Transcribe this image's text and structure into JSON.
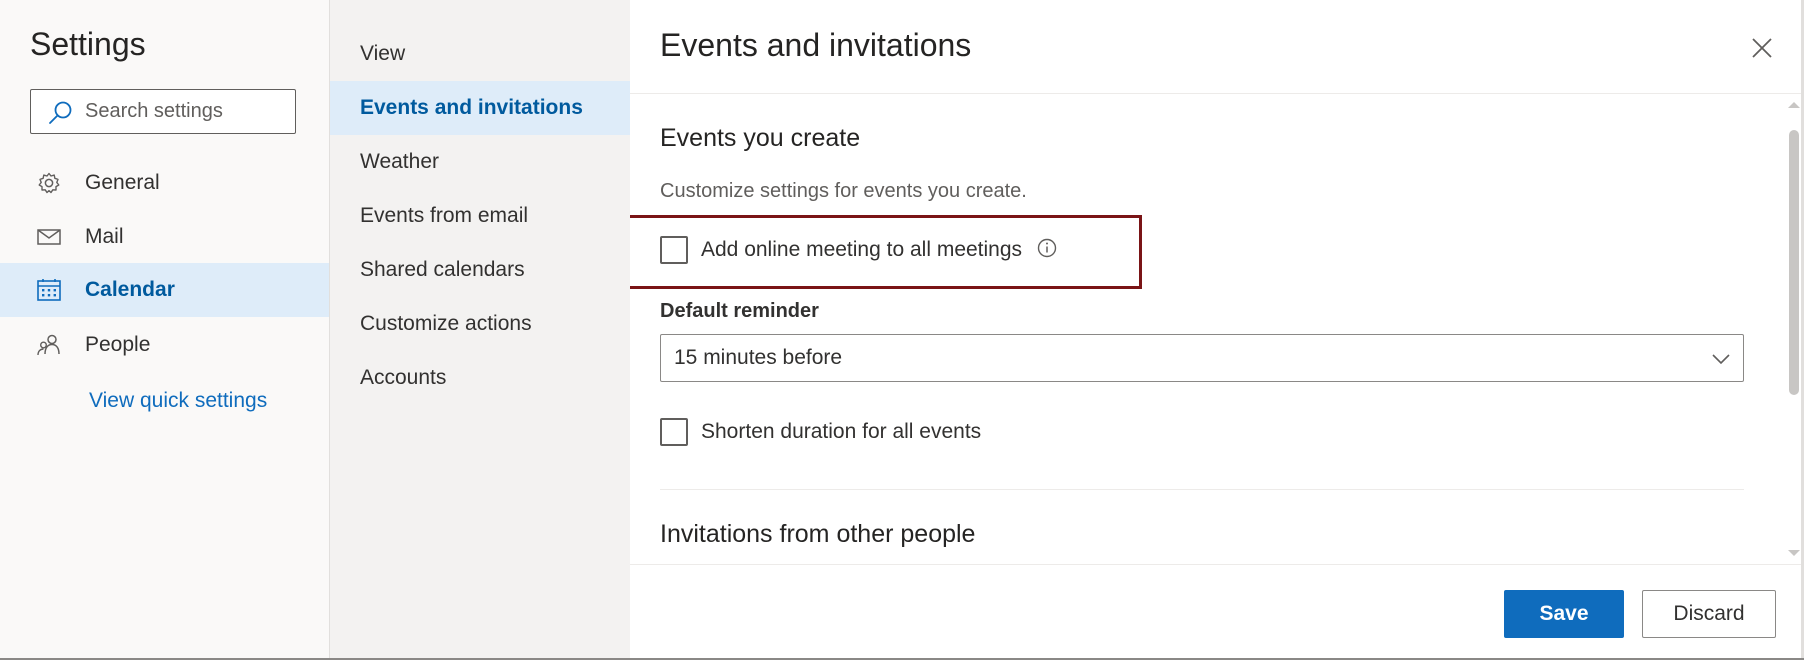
{
  "settings": {
    "title": "Settings",
    "search_placeholder": "Search settings",
    "nav": [
      {
        "label": "General",
        "icon": "gear-icon"
      },
      {
        "label": "Mail",
        "icon": "mail-icon"
      },
      {
        "label": "Calendar",
        "icon": "calendar-icon",
        "active": true
      },
      {
        "label": "People",
        "icon": "people-icon"
      }
    ],
    "quick_settings": "View quick settings"
  },
  "calendar_menu": {
    "items": [
      {
        "label": "View"
      },
      {
        "label": "Events and invitations",
        "active": true
      },
      {
        "label": "Weather"
      },
      {
        "label": "Events from email"
      },
      {
        "label": "Shared calendars"
      },
      {
        "label": "Customize actions"
      },
      {
        "label": "Accounts"
      }
    ]
  },
  "panel": {
    "title": "Events and invitations",
    "events_you_create": {
      "heading": "Events you create",
      "description": "Customize settings for events you create.",
      "online_meeting_label": "Add online meeting to all meetings",
      "online_meeting_checked": false,
      "default_reminder_label": "Default reminder",
      "default_reminder_value": "15 minutes before",
      "shorten_duration_label": "Shorten duration for all events",
      "shorten_duration_checked": false
    },
    "invitations_heading": "Invitations from other people",
    "save_label": "Save",
    "discard_label": "Discard"
  },
  "colors": {
    "accent": "#0f6cbd",
    "selected_bg": "#deecf9",
    "highlight_border": "#7a1416"
  }
}
